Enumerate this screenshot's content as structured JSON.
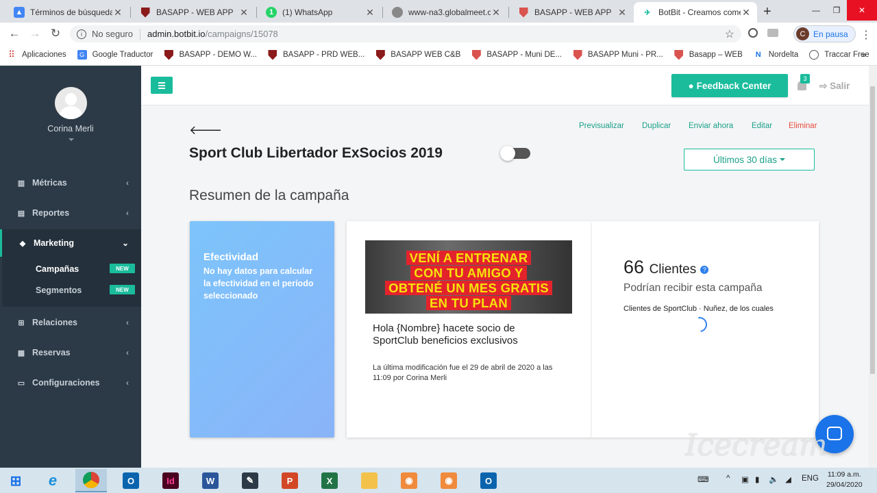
{
  "browser": {
    "tabs": [
      {
        "label": "Términos de búsqueda -",
        "icon_color": "#4285f4",
        "icon": "google-ads-icon"
      },
      {
        "label": "BASAPP - WEB APP",
        "icon_color": "#8b1a1a",
        "icon": "shield-icon"
      },
      {
        "label": "(1) WhatsApp",
        "icon_color": "#25d366",
        "icon": "whatsapp-icon"
      },
      {
        "label": "www-na3.globalmeet.co",
        "icon_color": "#888888",
        "icon": "globe-icon"
      },
      {
        "label": "BASAPP - WEB APP",
        "icon_color": "#8b1a1a",
        "icon": "shield-icon"
      },
      {
        "label": "BotBit - Creamos comer",
        "icon_color": "#1abc9c",
        "icon": "botbit-icon",
        "active": true
      }
    ],
    "address": {
      "security_label": "No seguro",
      "host": "admin.botbit.io",
      "path": "/campaigns/15078"
    },
    "profile": {
      "initial": "C",
      "status": "En pausa"
    },
    "bookmarks": [
      {
        "label": "Aplicaciones",
        "icon": "apps-grid-icon"
      },
      {
        "label": "Google Traductor",
        "icon": "google-translate-icon"
      },
      {
        "label": "BASAPP - DEMO W...",
        "icon": "shield-icon"
      },
      {
        "label": "BASAPP - PRD WEB...",
        "icon": "shield-icon"
      },
      {
        "label": "BASAPP WEB C&B",
        "icon": "shield-icon"
      },
      {
        "label": "BASAPP - Muni DE...",
        "icon": "shield-icon"
      },
      {
        "label": "BASAPP Muni - PR...",
        "icon": "shield-icon"
      },
      {
        "label": "Basapp – WEB",
        "icon": "shield-icon"
      },
      {
        "label": "Nordelta",
        "icon": "nordelta-icon"
      },
      {
        "label": "Traccar Free",
        "icon": "traccar-icon"
      }
    ]
  },
  "sidebar": {
    "user_name": "Corina Merli",
    "items": [
      {
        "label": "Métricas",
        "icon": "bar-chart-icon"
      },
      {
        "label": "Reportes",
        "icon": "document-icon"
      },
      {
        "label": "Marketing",
        "icon": "diamond-icon",
        "open": true
      },
      {
        "label": "Relaciones",
        "icon": "sitemap-icon"
      },
      {
        "label": "Reservas",
        "icon": "calendar-icon"
      },
      {
        "label": "Configuraciones",
        "icon": "laptop-icon"
      }
    ],
    "submenu": [
      {
        "label": "Campañas",
        "badge": "NEW",
        "current": true
      },
      {
        "label": "Segmentos",
        "badge": "NEW"
      }
    ]
  },
  "topbar": {
    "feedback_label": "Feedback Center",
    "notifications_count": "3",
    "logout_label": "Salir"
  },
  "campaign": {
    "title": "Sport Club Libertador ExSocios 2019",
    "enabled": false,
    "actions": {
      "preview": "Previsualizar",
      "duplicate": "Duplicar",
      "send_now": "Enviar ahora",
      "edit": "Editar",
      "delete": "Eliminar"
    },
    "date_range": "Últimos 30 días",
    "summary_title": "Resumen de la campaña",
    "effectiveness": {
      "title": "Efectividad",
      "text": "No hay datos para calcular la efectividad en el período seleccionado"
    },
    "banner_lines": [
      "VENÍ A ENTRENAR",
      "CON TU AMIGO Y",
      "OBTENÉ UN MES GRATIS",
      "EN TU PLAN"
    ],
    "message": "Hola {Nombre} hacete socio de SportClub beneficios exclusivos",
    "modified": "La última modificación fue el 29 de abril de 2020 a las 11:09 por Corina Merli",
    "clients_count": "66",
    "clients_label": "Clientes",
    "clients_sub": "Podrían recibir esta campaña",
    "clients_desc": "Clientes de SportClub · Nuñez, de los cuales"
  },
  "watermark": "Icecream",
  "taskbar": {
    "language": "ENG",
    "time": "11:09 a.m.",
    "date": "29/04/2020"
  },
  "colors": {
    "accent": "#1abc9c",
    "sidebar": "#2c3a47",
    "danger": "#e74c3c"
  }
}
